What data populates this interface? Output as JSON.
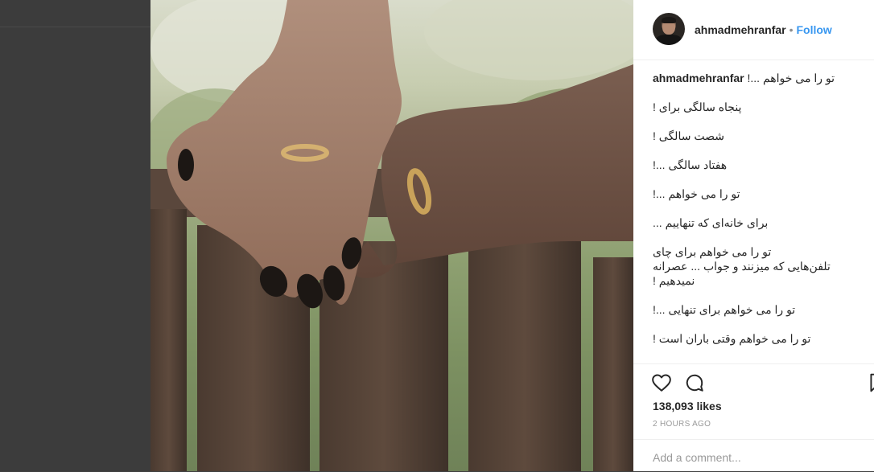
{
  "post": {
    "username": "ahmadmehranfar",
    "follow_label": "Follow",
    "separator": "•"
  },
  "caption": {
    "author": "ahmadmehranfar",
    "lines": [
      "!... تو را می خواهم",
      "! پنجاه سالگی برای",
      "! شصت سالگی",
      "!... هفتاد سالگی",
      "!... تو را می خواهم",
      "... برای خانه‌ای که تنهاییم",
      "تو را می خواهم برای چای",
      "تلفن‌هایی که میزنند و جواب ... عصرانه",
      "! نمیدهیم",
      "!... تو را می خواهم برای تنهایی",
      "! تو را می خواهم وقتی باران است"
    ]
  },
  "actions": {
    "like_icon": "heart-icon",
    "comment_icon": "comment-icon",
    "save_icon": "bookmark-icon"
  },
  "stats": {
    "likes": "138,093 likes",
    "time": "2 HOURS AGO"
  },
  "comment": {
    "placeholder": "Add a comment..."
  },
  "colors": {
    "link": "#3897f0",
    "text": "#262626",
    "muted": "#999999",
    "backdrop": "#3c3c3c"
  }
}
